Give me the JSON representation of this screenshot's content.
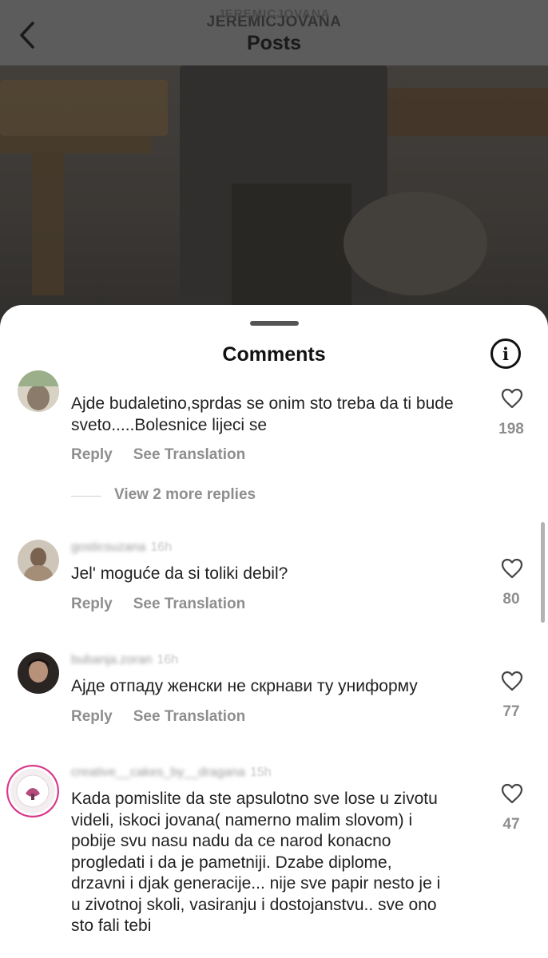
{
  "header": {
    "username_ghost": "JEREMICJOVANA",
    "username": "JEREMICJOVANA",
    "title": "Posts",
    "back_icon": "chevron-left-icon"
  },
  "sheet": {
    "title": "Comments",
    "info_icon": "i"
  },
  "comments": [
    {
      "user": "",
      "time": "",
      "text": "Ajde budaletino,sprdas se onim sto treba da ti bude sveto.....Bolesnice lijeci se",
      "reply": "Reply",
      "see_translation": "See Translation",
      "likes": "198",
      "view_more": "View 2 more replies"
    },
    {
      "user": "gosticsuzana",
      "time": "16h",
      "text": "Jel' moguće da si toliki debil?",
      "reply": "Reply",
      "see_translation": "See Translation",
      "likes": "80"
    },
    {
      "user": "bubanja.zoran",
      "time": "16h",
      "text": "Ајде отпаду женски не скрнави ту униформу",
      "reply": "Reply",
      "see_translation": "See Translation",
      "likes": "77"
    },
    {
      "user": "creative__cakes_by__dragana",
      "time": "15h",
      "text": "Kada pomislite da ste apsulotno sve lose u zivotu videli, iskoci jovana( namerno malim slovom) i pobije svu nasu nadu da ce narod konacno progledati i da je pametniji. Dzabe diplome, drzavni i djak generacije... nije sve papir nesto je i u zivotnoj skoli, vasiranju i dostojanstvu.. sve ono sto fali tebi",
      "likes": "47"
    }
  ],
  "colors": {
    "header_bg": "#5c5c5c",
    "sheet_bg": "#ffffff",
    "muted_text": "#8e8e8e",
    "body_text": "#222222"
  }
}
